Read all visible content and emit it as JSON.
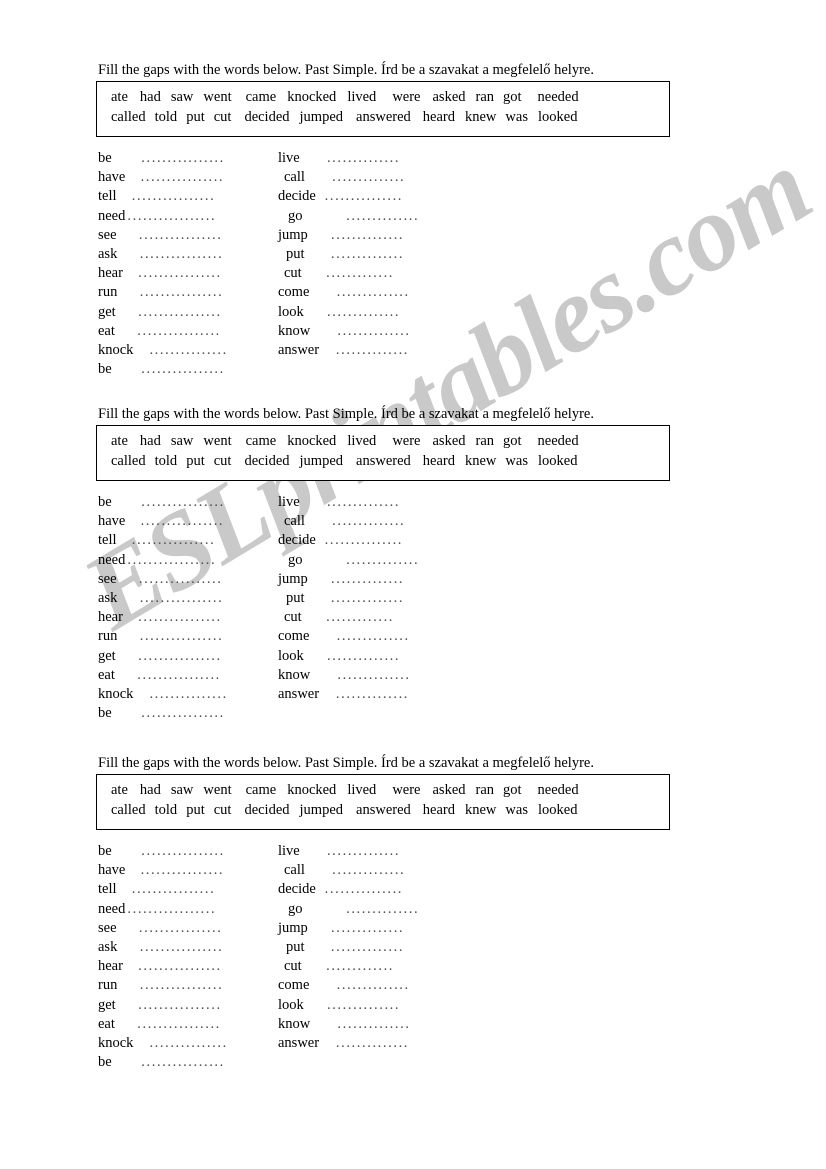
{
  "document": {
    "watermark": "ESLprintables.com",
    "watermark_color": "#c9c9c9",
    "background_color": "#ffffff",
    "text_color": "#000000"
  },
  "instruction": "Fill the gaps with the words below. Past Simple. Írd be a szavakat a megfelelő helyre.",
  "word_bank": {
    "row1": [
      "ate",
      "had",
      "saw",
      "went",
      "came",
      "knocked",
      "lived",
      "were",
      "asked",
      "ran",
      "got",
      "needed"
    ],
    "row2": [
      "called",
      "told",
      "put",
      "cut",
      "decided",
      "jumped",
      "answered",
      "heard",
      "knew",
      "was",
      "looked"
    ],
    "row1_text": "ate   had  saw  went   came  knocked  lived    were   asked  ran got   needed",
    "row2_text": "called  told  put  cut   decided  jumped   answered   heard  knew  was  looked"
  },
  "verbs": {
    "left_column": [
      "be",
      "have",
      "tell",
      "need",
      "see",
      "ask",
      "hear",
      "run",
      "get",
      "eat",
      "knock",
      "be"
    ],
    "right_column": [
      "live",
      "call",
      "decide",
      "go",
      "jump",
      "put",
      "cut",
      "come",
      "look",
      "know",
      "answer"
    ],
    "gap_dots": "................."
  },
  "sections": [
    {
      "index": 1,
      "label": "exercise-1"
    },
    {
      "index": 2,
      "label": "exercise-2"
    },
    {
      "index": 3,
      "label": "exercise-3"
    }
  ]
}
